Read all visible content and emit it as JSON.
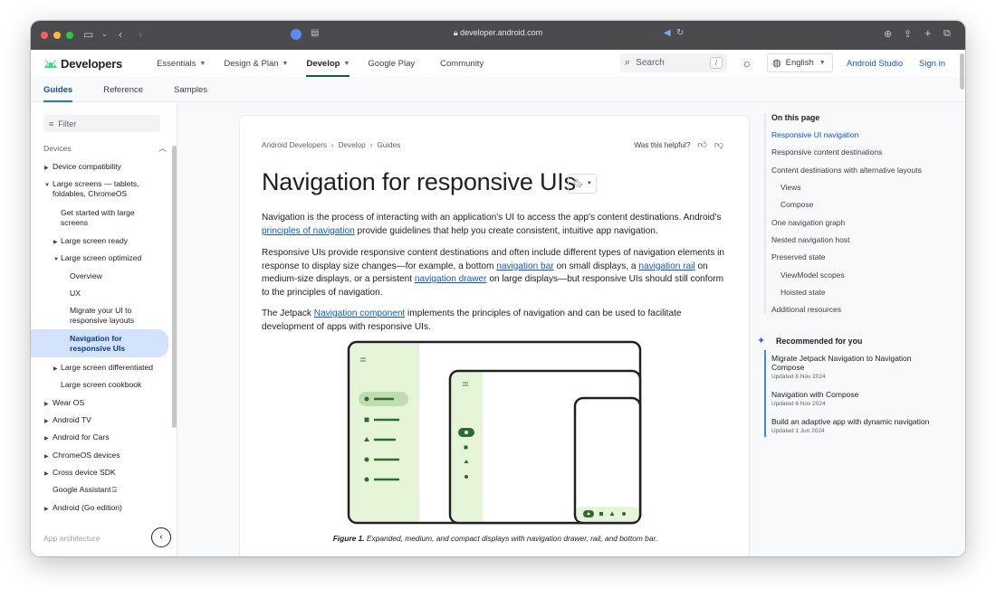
{
  "browser": {
    "url": "developer.android.com"
  },
  "header": {
    "logo_text": "Developers",
    "nav": [
      {
        "label": "Essentials",
        "has_menu": true
      },
      {
        "label": "Design & Plan",
        "has_menu": true
      },
      {
        "label": "Develop",
        "has_menu": true,
        "active": true
      },
      {
        "label": "Google Play",
        "has_menu": false
      },
      {
        "label": "Community",
        "has_menu": false
      }
    ],
    "search_placeholder": "Search",
    "search_shortcut": "/",
    "language": "English",
    "studio_link": "Android Studio",
    "signin_link": "Sign in"
  },
  "subtabs": [
    "Guides",
    "Reference",
    "Samples"
  ],
  "sidebar": {
    "filter_placeholder": "Filter",
    "items": [
      {
        "label": "Devices",
        "level": 0,
        "arrow": "up",
        "heading": true
      },
      {
        "label": "Device compatibility",
        "level": 1,
        "arrow": "right"
      },
      {
        "label": "Large screens — tablets, foldables, ChromeOS",
        "level": 1,
        "arrow": "down"
      },
      {
        "label": "Get started with large screens",
        "level": 2,
        "arrow": ""
      },
      {
        "label": "Large screen ready",
        "level": 2,
        "arrow": "right"
      },
      {
        "label": "Large screen optimized",
        "level": 2,
        "arrow": "down"
      },
      {
        "label": "Overview",
        "level": 3,
        "arrow": ""
      },
      {
        "label": "UX",
        "level": 3,
        "arrow": ""
      },
      {
        "label": "Migrate your UI to responsive layouts",
        "level": 3,
        "arrow": ""
      },
      {
        "label": "Navigation for responsive UIs",
        "level": 3,
        "arrow": "",
        "active": true
      },
      {
        "label": "Large screen differentiated",
        "level": 2,
        "arrow": "right"
      },
      {
        "label": "Large screen cookbook",
        "level": 2,
        "arrow": ""
      },
      {
        "label": "Wear OS",
        "level": 1,
        "arrow": "right"
      },
      {
        "label": "Android TV",
        "level": 1,
        "arrow": "right"
      },
      {
        "label": "Android for Cars",
        "level": 1,
        "arrow": "right"
      },
      {
        "label": "ChromeOS devices",
        "level": 1,
        "arrow": "right"
      },
      {
        "label": "Cross device SDK",
        "level": 1,
        "arrow": "right"
      },
      {
        "label": "Google Assistant",
        "level": 1,
        "arrow": "",
        "external": true
      },
      {
        "label": "Android (Go edition)",
        "level": 1,
        "arrow": "right"
      },
      {
        "label": "App architecture",
        "level": 0,
        "arrow": "",
        "heading": true
      }
    ]
  },
  "article": {
    "breadcrumbs": [
      "Android Developers",
      "Develop",
      "Guides"
    ],
    "helpful_text": "Was this helpful?",
    "title": "Navigation for responsive UIs",
    "p1": {
      "a": "Navigation is the process of interacting with an application's UI to access the app's content destinations. Android's ",
      "link1": "principles of navigation",
      "b": " provide guidelines that help you create consistent, intuitive app navigation."
    },
    "p2": {
      "a": "Responsive UIs provide responsive content destinations and often include different types of navigation elements in response to display size changes—for example, a bottom ",
      "link1": "navigation bar",
      "b": " on small displays, a ",
      "link2": "navigation rail",
      "c": " on medium-size displays, or a persistent ",
      "link3": "navigation drawer",
      "d": " on large displays—but responsive UIs should still conform to the principles of navigation."
    },
    "p3": {
      "a": "The Jetpack ",
      "link1": "Navigation component",
      "b": " implements the principles of navigation and can be used to facilitate development of apps with responsive UIs."
    },
    "figure_label": "Figure 1.",
    "figure_caption": " Expanded, medium, and compact displays with navigation drawer, rail, and bottom bar."
  },
  "toc": {
    "title": "On this page",
    "items": [
      {
        "label": "Responsive UI navigation",
        "indent": 0,
        "active": true
      },
      {
        "label": "Responsive content destinations",
        "indent": 0
      },
      {
        "label": "Content destinations with alternative layouts",
        "indent": 0
      },
      {
        "label": "Views",
        "indent": 1
      },
      {
        "label": "Compose",
        "indent": 1
      },
      {
        "label": "One navigation graph",
        "indent": 0
      },
      {
        "label": "Nested navigation host",
        "indent": 0
      },
      {
        "label": "Preserved state",
        "indent": 0
      },
      {
        "label": "ViewModel scopes",
        "indent": 1
      },
      {
        "label": "Hoisted state",
        "indent": 1
      },
      {
        "label": "Additional resources",
        "indent": 0
      }
    ],
    "recommended_title": "Recommended for you",
    "recommended": [
      {
        "title": "Migrate Jetpack Navigation to Navigation Compose",
        "date": "Updated 6 Nov 2024"
      },
      {
        "title": "Navigation with Compose",
        "date": "Updated 6 Nov 2024"
      },
      {
        "title": "Build an adaptive app with dynamic navigation",
        "date": "Updated 1 Jun 2024"
      }
    ]
  },
  "colors": {
    "accent": "#0b57d0",
    "active_nav_bg": "#d3e3fd",
    "figure_green": "#e6f4d7",
    "figure_dark_green": "#4f9a5a"
  }
}
